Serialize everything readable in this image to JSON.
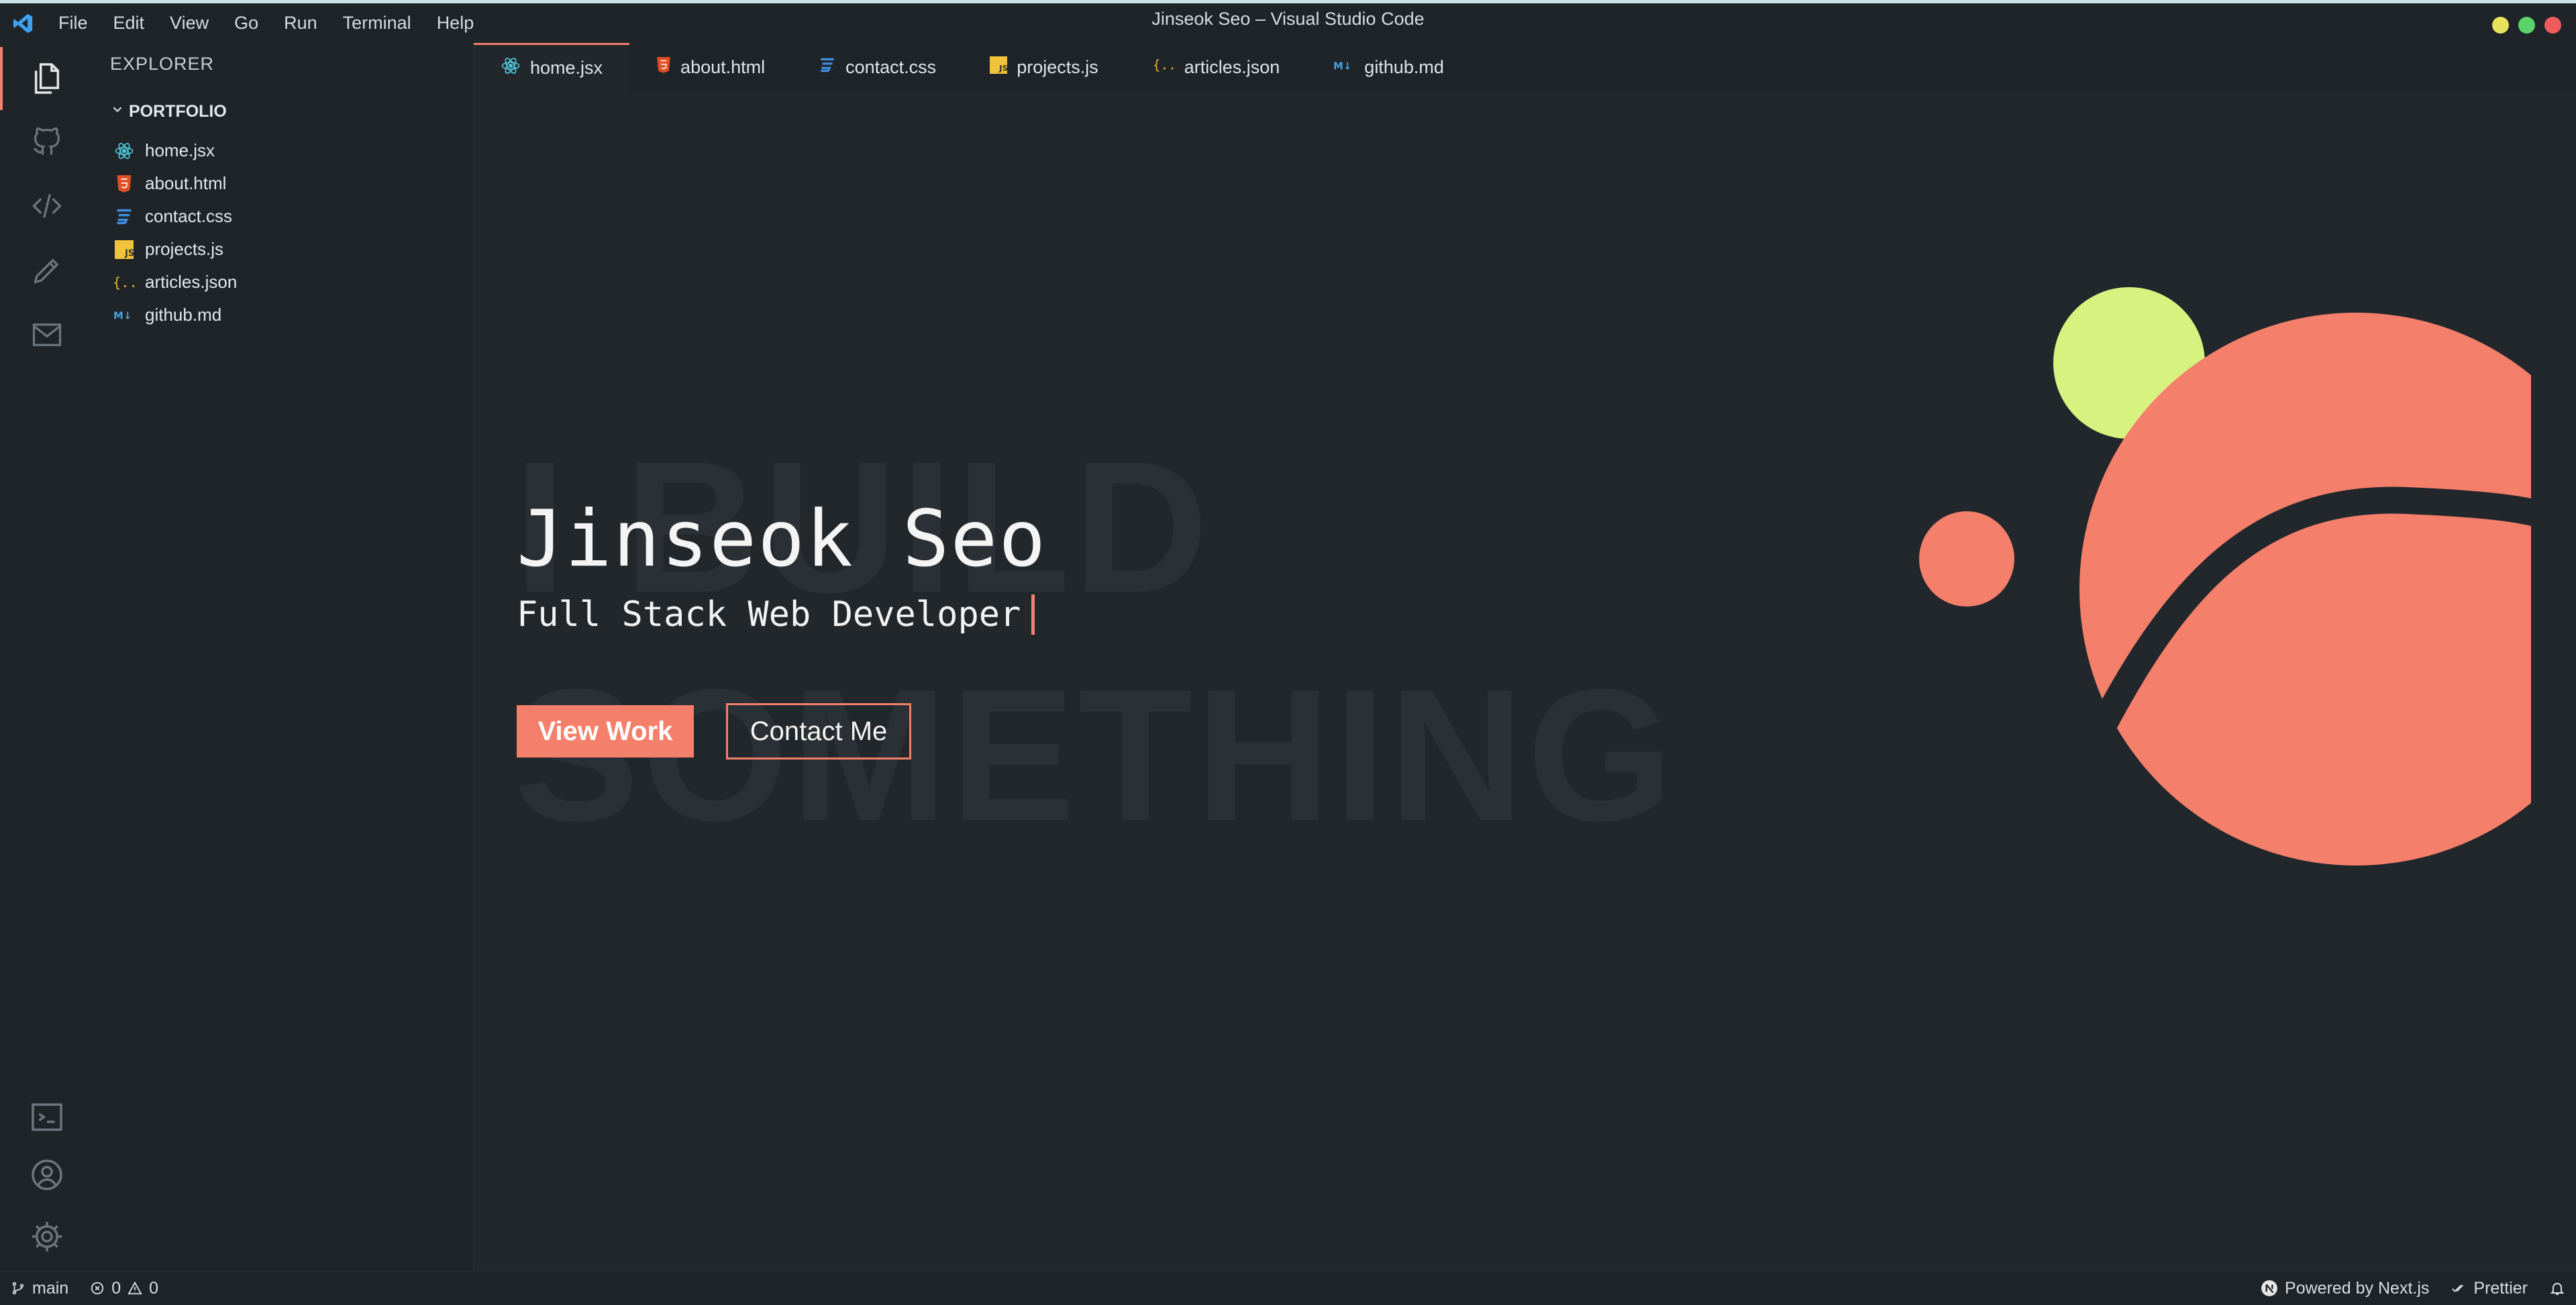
{
  "window": {
    "title": "Jinseok Seo – Visual Studio Code"
  },
  "menu": [
    "File",
    "Edit",
    "View",
    "Go",
    "Run",
    "Terminal",
    "Help"
  ],
  "sidebar": {
    "title": "EXPLORER",
    "folder": "PORTFOLIO",
    "files": [
      {
        "label": "home.jsx",
        "icon": "react-icon"
      },
      {
        "label": "about.html",
        "icon": "html-icon"
      },
      {
        "label": "contact.css",
        "icon": "css-icon"
      },
      {
        "label": "projects.js",
        "icon": "js-icon"
      },
      {
        "label": "articles.json",
        "icon": "json-icon"
      },
      {
        "label": "github.md",
        "icon": "markdown-icon"
      }
    ]
  },
  "tabs": [
    {
      "label": "home.jsx",
      "active": true
    },
    {
      "label": "about.html"
    },
    {
      "label": "contact.css"
    },
    {
      "label": "projects.js"
    },
    {
      "label": "articles.json"
    },
    {
      "label": "github.md"
    }
  ],
  "hero": {
    "name": "Jinseok Seo",
    "role": "Full Stack Web Developer",
    "bg_line1": "I BUILD",
    "bg_line2": "SOMETHING",
    "primary_label": "View Work",
    "secondary_label": "Contact Me"
  },
  "status": {
    "branch": "main",
    "errors": "0",
    "warnings": "0",
    "powered": "Powered by Next.js",
    "prettier": "Prettier"
  },
  "colors": {
    "accent": "#f47f6b",
    "yellow": "#d8f27f",
    "bg": "#22272b"
  }
}
